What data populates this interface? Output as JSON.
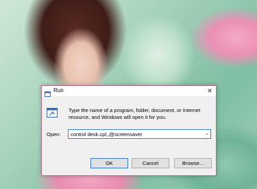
{
  "dialog": {
    "title": "Run",
    "close_glyph": "✕",
    "instruction": "Type the name of a program, folder, document, or Internet resource, and Windows will open it for you.",
    "open_label": "Open:",
    "open_value": "control desk.cpl,,@screensaver",
    "dropdown_glyph": "⌄",
    "buttons": {
      "ok": "OK",
      "cancel": "Cancel",
      "browse": "Browse..."
    },
    "icons": {
      "title_icon": "run-icon",
      "app_icon": "run-app-icon"
    },
    "accent_color": "#3a7fd1"
  }
}
